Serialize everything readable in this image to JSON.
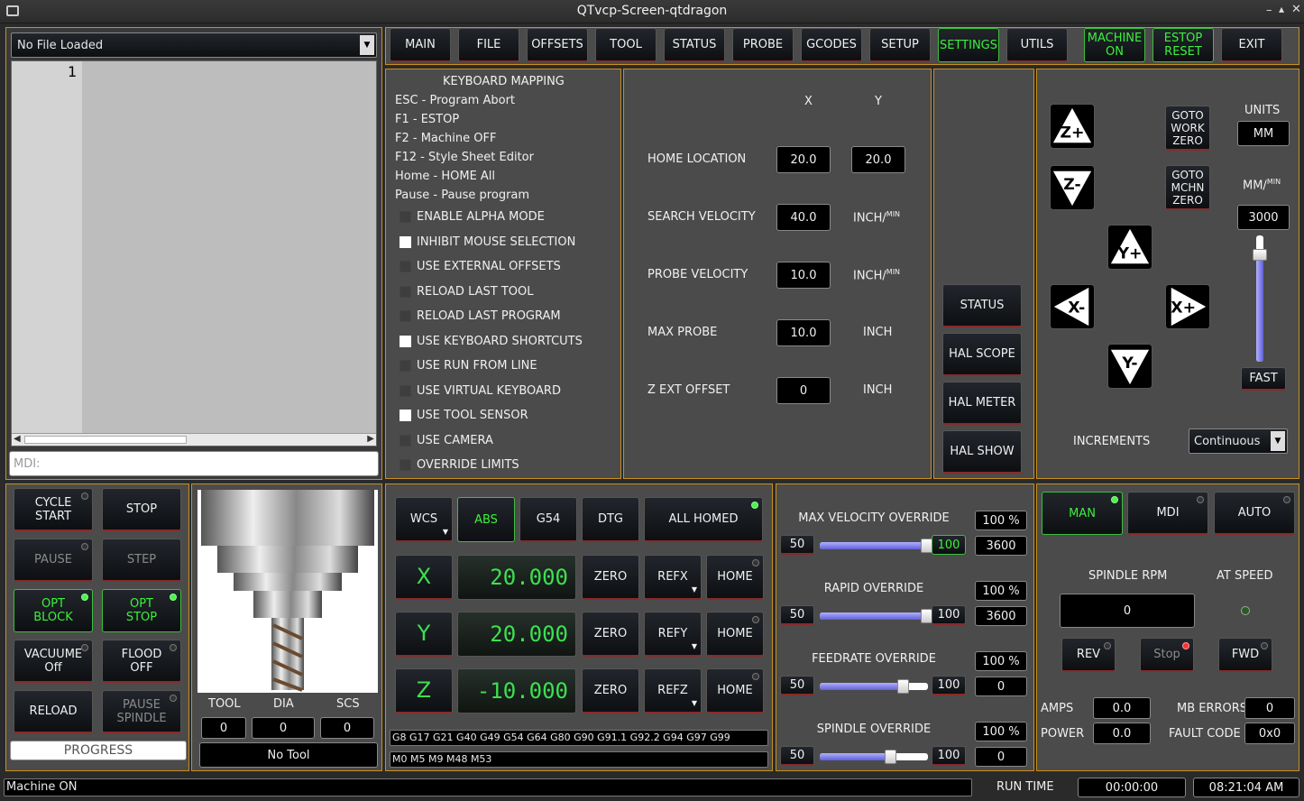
{
  "window": {
    "title": "QTvcp-Screen-qtdragon"
  },
  "file": {
    "name": "No File Loaded",
    "line": "1",
    "mdi_placeholder": "MDI:"
  },
  "tabs": [
    "MAIN",
    "FILE",
    "OFFSETS",
    "TOOL",
    "STATUS",
    "PROBE",
    "GCODES",
    "SETUP",
    "SETTINGS",
    "UTILS"
  ],
  "top_buttons": {
    "machine_on": "MACHINE\nON",
    "estop_reset": "ESTOP\nRESET",
    "exit": "EXIT"
  },
  "keymap": {
    "title": "KEYBOARD MAPPING",
    "items": [
      "ESC - Program Abort",
      "F1 - ESTOP",
      "F2 - Machine OFF",
      "F12 - Style Sheet Editor",
      "Home - HOME All",
      "Pause - Pause program"
    ]
  },
  "options": [
    {
      "label": "ENABLE ALPHA MODE",
      "checked": false
    },
    {
      "label": "INHIBIT MOUSE SELECTION",
      "checked": true
    },
    {
      "label": "USE EXTERNAL OFFSETS",
      "checked": false
    },
    {
      "label": "RELOAD LAST TOOL",
      "checked": false
    },
    {
      "label": "RELOAD LAST PROGRAM",
      "checked": false
    },
    {
      "label": "USE KEYBOARD SHORTCUTS",
      "checked": true
    },
    {
      "label": "USE RUN FROM LINE",
      "checked": false
    },
    {
      "label": "USE VIRTUAL KEYBOARD",
      "checked": false
    },
    {
      "label": "USE TOOL SENSOR",
      "checked": true
    },
    {
      "label": "USE CAMERA",
      "checked": false
    },
    {
      "label": "OVERRIDE LIMITS",
      "checked": false
    }
  ],
  "probe_settings": {
    "col_x": "X",
    "col_y": "Y",
    "home_location": {
      "label": "HOME LOCATION",
      "x": "20.0",
      "y": "20.0"
    },
    "search_velocity": {
      "label": "SEARCH VELOCITY",
      "value": "40.0",
      "unit": "INCH/",
      "sup": "MIN"
    },
    "probe_velocity": {
      "label": "PROBE VELOCITY",
      "value": "10.0",
      "unit": "INCH/",
      "sup": "MIN"
    },
    "max_probe": {
      "label": "MAX PROBE",
      "value": "10.0",
      "unit": "INCH"
    },
    "z_ext_offset": {
      "label": "Z EXT OFFSET",
      "value": "0",
      "unit": "INCH"
    }
  },
  "hal": {
    "status": "STATUS",
    "scope": "HAL SCOPE",
    "meter": "HAL METER",
    "show": "HAL SHOW"
  },
  "jog": {
    "goto_work": "GOTO\nWORK\nZERO",
    "goto_mchn": "GOTO\nMCHN\nZERO",
    "units_label": "UNITS",
    "units": "MM",
    "rate_label": "MM/",
    "rate_sup": "MIN",
    "rate": "3000",
    "fast": "FAST",
    "increments_label": "INCREMENTS",
    "increments": "Continuous",
    "rate_slider": 0.85
  },
  "cycle": {
    "cycle_start": "CYCLE\nSTART",
    "stop": "STOP",
    "pause": "PAUSE",
    "step": "STEP",
    "opt_block": "OPT\nBLOCK",
    "opt_stop": "OPT\nSTOP",
    "vacuum": "VACUUME\nOff",
    "flood": "FLOOD\nOFF",
    "reload": "RELOAD",
    "pause_spindle": "PAUSE\nSPINDLE",
    "progress": "PROGRESS"
  },
  "tool": {
    "tool_label": "TOOL",
    "dia_label": "DIA",
    "scs_label": "SCS",
    "tool": "0",
    "dia": "0",
    "scs": "0",
    "name": "No Tool"
  },
  "dro": {
    "wcs": "WCS",
    "abs": "ABS",
    "g54": "G54",
    "dtg": "DTG",
    "all_homed": "ALL HOMED",
    "axes": [
      {
        "axis": "X",
        "value": "20.000",
        "zero": "ZERO",
        "ref": "REFX",
        "home": "HOME"
      },
      {
        "axis": "Y",
        "value": "20.000",
        "zero": "ZERO",
        "ref": "REFY",
        "home": "HOME"
      },
      {
        "axis": "Z",
        "value": "-10.000",
        "zero": "ZERO",
        "ref": "REFZ",
        "home": "HOME"
      }
    ],
    "gcodes": "G8 G17 G21 G40 G49 G54 G64 G80 G90 G91.1 G92.2 G94 G97 G99",
    "mcodes": "M0 M5 M9 M48 M53"
  },
  "overrides": [
    {
      "label": "MAX VELOCITY OVERRIDE",
      "min": "50",
      "max": "100",
      "pct": "100 %",
      "value": "3600",
      "level": 1.0
    },
    {
      "label": "RAPID OVERRIDE",
      "min": "50",
      "max": "100",
      "pct": "100 %",
      "value": "3600",
      "level": 1.0
    },
    {
      "label": "FEEDRATE OVERRIDE",
      "min": "50",
      "max": "100",
      "pct": "100 %",
      "value": "0",
      "level": 0.78
    },
    {
      "label": "SPINDLE OVERRIDE",
      "min": "50",
      "max": "100",
      "pct": "100 %",
      "value": "0",
      "level": 0.67
    }
  ],
  "modes": {
    "man": "MAN",
    "mdi": "MDI",
    "auto": "AUTO"
  },
  "spindle": {
    "rpm_label": "SPINDLE RPM",
    "at_speed": "AT SPEED",
    "rpm": "0",
    "rev": "REV",
    "stop": "Stop",
    "fwd": "FWD",
    "amps_label": "AMPS",
    "amps": "0.0",
    "mb_label": "MB ERRORS",
    "mb": "0",
    "power_label": "POWER",
    "power": "0.0",
    "fault_label": "FAULT CODE",
    "fault": "0x0"
  },
  "status": {
    "message": "Machine ON",
    "run_time_label": "RUN TIME",
    "run_time": "00:00:00",
    "clock": "08:21:04 AM"
  }
}
